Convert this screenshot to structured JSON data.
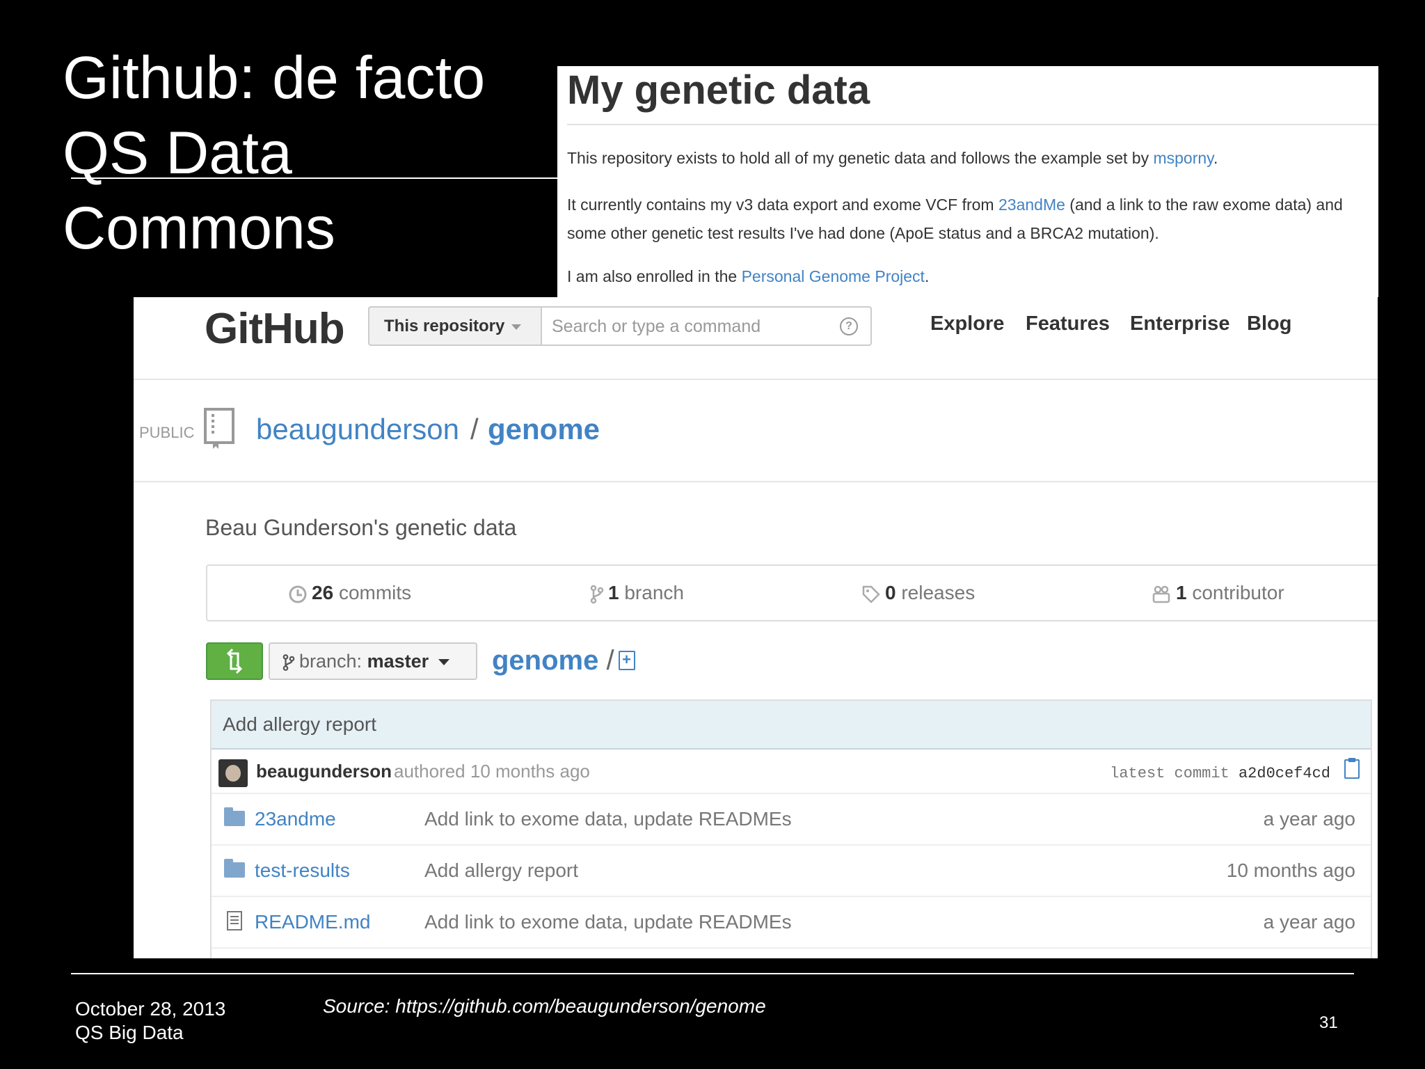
{
  "slide": {
    "title_lines": [
      "Github: de facto",
      "QS Data",
      "Commons"
    ],
    "footer_date": "October 28, 2013",
    "footer_event": "QS Big Data",
    "source": "Source: https://github.com/beaugunderson/genome",
    "page_number": "31"
  },
  "readme": {
    "heading": "My genetic data",
    "p1_text": "This repository exists to hold all of my genetic data and follows the example set by ",
    "p1_link": "msporny",
    "p1_end": ".",
    "p2_text": "It currently contains my v3 data export and exome VCF from ",
    "p2_link": "23andMe",
    "p2_end": " (and a link to the raw exome data) and some other genetic test results I've had done (ApoE status and a BRCA2 mutation).",
    "p3_text": "I am also enrolled in the ",
    "p3_link": "Personal Genome Project",
    "p3_end": ".",
    "link_color": "#4183c4"
  },
  "header": {
    "logo": "GitHub",
    "scope": "This repository",
    "search_placeholder": "Search or type a command",
    "help_glyph": "?",
    "nav": [
      "Explore",
      "Features",
      "Enterprise",
      "Blog"
    ]
  },
  "repo": {
    "visibility": "PUBLIC",
    "owner": "beaugunderson",
    "separator": "/",
    "name": "genome",
    "description": "Beau Gunderson's genetic data"
  },
  "stats": {
    "commits_count": "26",
    "commits_label": "commits",
    "branch_count": "1",
    "branch_label": "branch",
    "releases_count": "0",
    "releases_label": "releases",
    "contributors_count": "1",
    "contributors_label": "contributor"
  },
  "toolbar": {
    "branch_prefix": "branch:",
    "branch_name": "master",
    "breadcrumb_repo": "genome",
    "breadcrumb_sep": "/",
    "new_file_glyph": "+",
    "compare_color": "#60b044"
  },
  "commit": {
    "message": "Add allergy report",
    "author": "beaugunderson",
    "authored_text": "authored 10 months ago",
    "latest_label": "latest commit",
    "sha": "a2d0cef4cd"
  },
  "files": [
    {
      "name": "23andme",
      "type": "folder",
      "message": "Add link to exome data, update READMEs",
      "age": "a year ago"
    },
    {
      "name": "test-results",
      "type": "folder",
      "message": "Add allergy report",
      "age": "10 months ago"
    },
    {
      "name": "README.md",
      "type": "file",
      "message": "Add link to exome data, update READMEs",
      "age": "a year ago"
    }
  ]
}
